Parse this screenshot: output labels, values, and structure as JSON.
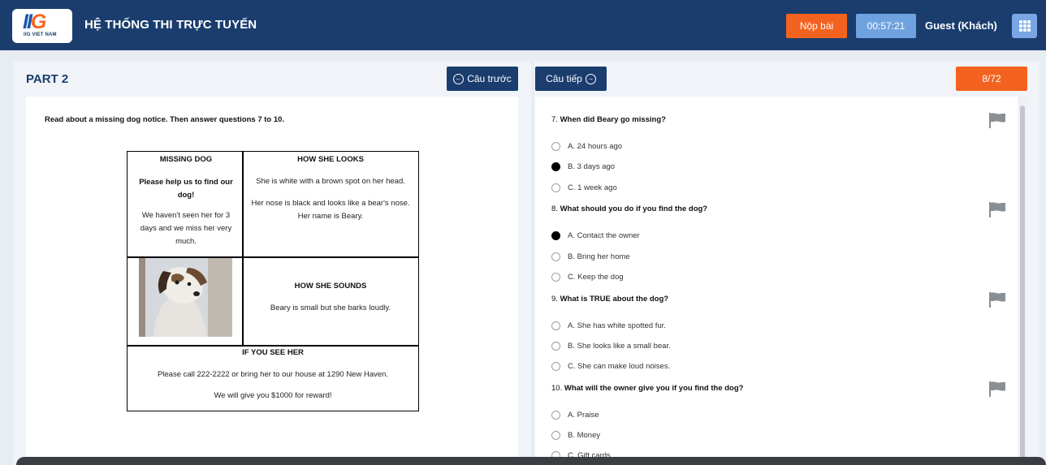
{
  "header": {
    "logo_mark_1": "II",
    "logo_mark_2": "G",
    "logo_text": "IIG VIET NAM",
    "title": "HỆ THỐNG THI TRỰC TUYẾN",
    "submit_label": "Nộp bài",
    "timer": "00:57:21",
    "user": "Guest (Khách)",
    "menu_icon": "grid-icon"
  },
  "nav": {
    "part_title": "PART 2",
    "prev_label": "Câu trước",
    "next_label": "Câu tiếp",
    "progress": "8/72"
  },
  "reading": {
    "instruction": "Read about a missing dog notice. Then answer questions 7 to 10.",
    "notice": {
      "missing_heading": "MISSING DOG",
      "missing_plea": "Please help us to find our dog!",
      "missing_text": "We haven't seen her for 3 days and we miss her very much.",
      "looks_heading": "HOW SHE LOOKS",
      "looks_text_1": "She is white with a brown spot on her head.",
      "looks_text_2": "Her nose is black and looks like a bear's nose. Her name is Beary.",
      "sounds_heading": "HOW SHE SOUNDS",
      "sounds_text": "Beary is small but she barks loudly.",
      "see_heading": "IF YOU SEE HER",
      "see_text_1": "Please call 222-2222 or bring her to our house at 1290 New Haven.",
      "see_text_2": "We will give you $1000 for reward!"
    }
  },
  "questions": [
    {
      "number": "7.",
      "text": "When did Beary go missing?",
      "options": [
        {
          "label": "A. 24 hours ago",
          "selected": false
        },
        {
          "label": "B. 3 days ago",
          "selected": true
        },
        {
          "label": "C. 1 week ago",
          "selected": false
        }
      ]
    },
    {
      "number": "8.",
      "text": "What should you do if you find the dog?",
      "options": [
        {
          "label": "A. Contact the owner",
          "selected": true
        },
        {
          "label": "B. Bring her home",
          "selected": false
        },
        {
          "label": "C. Keep the dog",
          "selected": false
        }
      ]
    },
    {
      "number": "9.",
      "text": "What is TRUE about the dog?",
      "options": [
        {
          "label": "A. She has white spotted fur.",
          "selected": false
        },
        {
          "label": "B. She looks like a small bear.",
          "selected": false
        },
        {
          "label": "C. She can make loud noises.",
          "selected": false
        }
      ]
    },
    {
      "number": "10.",
      "text": "What will the owner give you if you find the dog?",
      "options": [
        {
          "label": "A. Praise",
          "selected": false
        },
        {
          "label": "B. Money",
          "selected": false
        },
        {
          "label": "C. Gift cards",
          "selected": false
        }
      ]
    }
  ],
  "colors": {
    "header_bg": "#1a3d6e",
    "accent_orange": "#f4621f",
    "timer_blue": "#6fa3e0"
  }
}
